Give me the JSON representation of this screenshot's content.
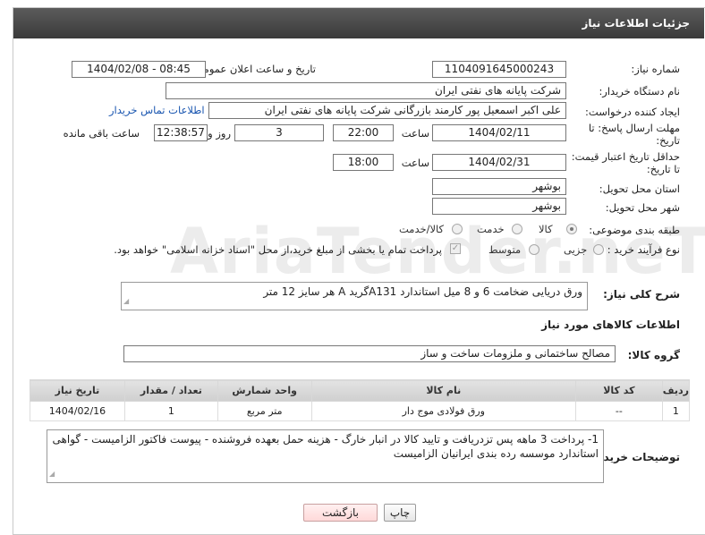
{
  "header": {
    "title": "جزئیات اطلاعات نیاز"
  },
  "form": {
    "need_number_label": "شماره نیاز:",
    "need_number": "1104091645000243",
    "announce_label": "تاریخ و ساعت اعلان عمومی:",
    "announce_value": "1404/02/08 - 08:45",
    "buyer_org_label": "نام دستگاه خریدار:",
    "buyer_org": "شرکت پایانه های نفتی ایران",
    "creator_label": "ایجاد کننده درخواست:",
    "creator": "علی اکبر اسمعیل پور کارمند بازرگانی شرکت پایانه های نفتی ایران",
    "contact_link": "اطلاعات تماس خریدار",
    "deadline_label_1": "مهلت ارسال پاسخ: تا",
    "deadline_label_2": "تاریخ:",
    "deadline_date": "1404/02/11",
    "hour_label": "ساعت",
    "deadline_time": "22:00",
    "days_value": "3",
    "days_label": "روز و",
    "remaining_time": "12:38:57",
    "remaining_label": "ساعت باقی مانده",
    "validity_label_1": "حداقل تاریخ اعتبار قیمت:",
    "validity_label_2": "تا تاریخ:",
    "validity_date": "1404/02/31",
    "validity_hour_label": "ساعت",
    "validity_time": "18:00",
    "province_label": "استان محل تحویل:",
    "province": "بوشهر",
    "city_label": "شهر محل تحویل:",
    "city": "بوشهر",
    "category_label": "طبقه بندی موضوعی:",
    "category_options": [
      "کالا",
      "خدمت",
      "کالا/خدمت"
    ],
    "category_selected": "کالا",
    "process_label": "نوع فرآیند خرید :",
    "process_options": [
      "جزیی",
      "متوسط"
    ],
    "payment_note": "پرداخت تمام یا بخشی از مبلغ خرید،از محل \"اسناد خزانه اسلامی\" خواهد بود.",
    "summary_label": "شرح کلی نیاز:",
    "summary": "ورق دریایی ضخامت 6 و 8 میل استاندارد A131گرید A هر سایز 12 متر"
  },
  "goods": {
    "section_title": "اطلاعات کالاهای مورد نیاز",
    "group_label": "گروه کالا:",
    "group_value": "مصالح ساختمانی و ملزومات ساخت و ساز",
    "columns": [
      "ردیف",
      "کد کالا",
      "نام کالا",
      "واحد شمارش",
      "تعداد / مقدار",
      "تاریخ نیاز"
    ],
    "rows": [
      {
        "row": "1",
        "code": "--",
        "name": "ورق فولادی موج دار",
        "unit": "متر مربع",
        "qty": "1",
        "date": "1404/02/16"
      }
    ]
  },
  "buyer_notes": {
    "label": "توضیحات خریدار:",
    "text": "1- پرداخت 3 ماهه پس تزدریافت و تایید کالا در انبار خارگ - هزینه حمل بعهده فروشنده - پیوست فاکتور الزامیست - گواهی استاندارد موسسه رده بندی ایرانیان الزامیست"
  },
  "actions": {
    "print": "چاپ",
    "back": "بازگشت"
  },
  "watermark": "AriaTender.neT"
}
